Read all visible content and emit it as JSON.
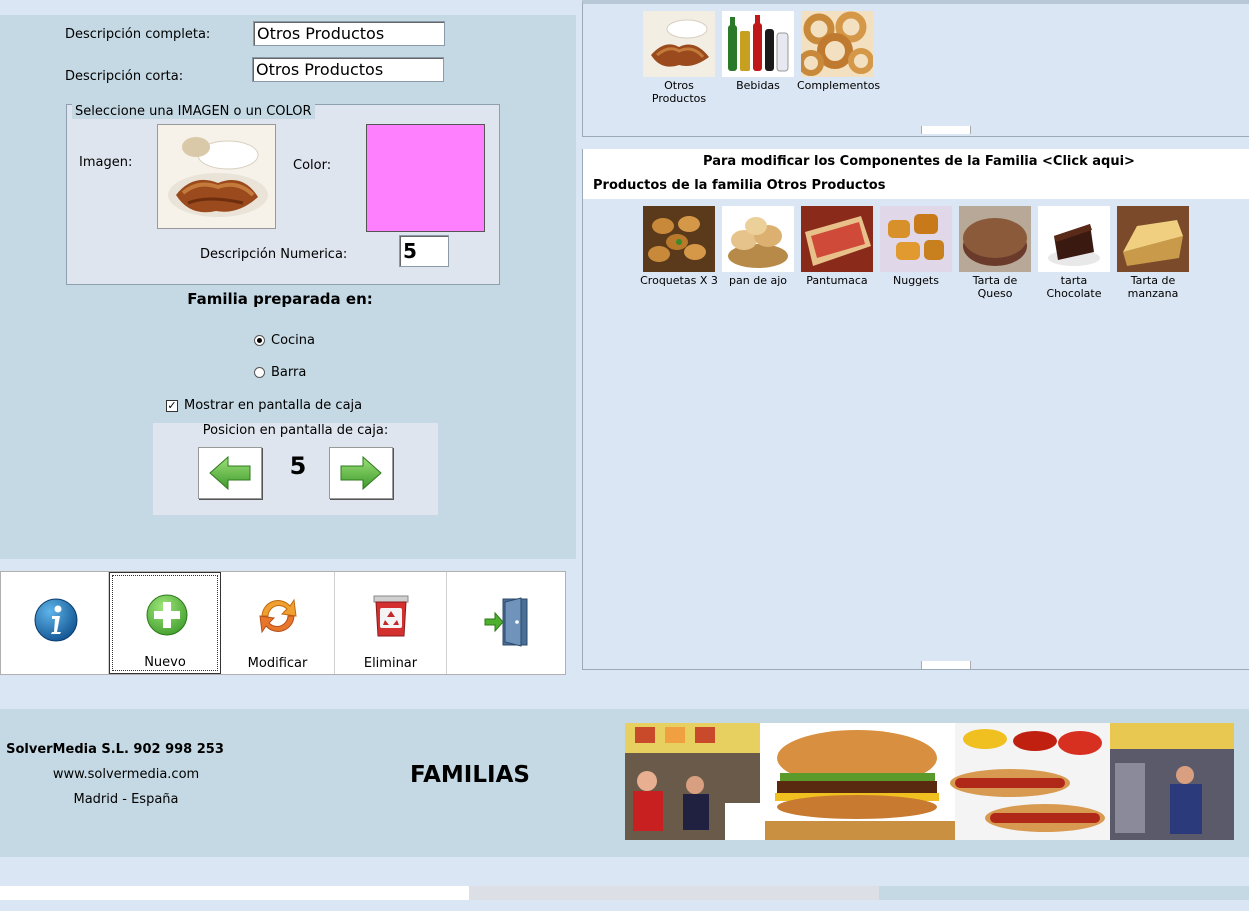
{
  "form": {
    "full_desc_label": "Descripción completa:",
    "full_desc_value": "Otros Productos",
    "short_desc_label": "Descripción corta:",
    "short_desc_value": "Otros Productos",
    "image_group_title": "Seleccione una IMAGEN o un COLOR",
    "image_label": "Imagen:",
    "color_label": "Color:",
    "color_value": "#ff80ff",
    "numeric_label": "Descripción Numerica:",
    "numeric_value": "5",
    "prepared_title": "Familia preparada en:",
    "options": [
      {
        "label": "Cocina",
        "selected": true
      },
      {
        "label": "Barra",
        "selected": false
      }
    ],
    "show_checkbox_label": "Mostrar en pantalla de caja",
    "show_checked": true,
    "position_title": "Posicion en pantalla de caja:",
    "position_value": "5"
  },
  "toolbar": {
    "info_icon": "info-icon",
    "new_label": "Nuevo",
    "modify_label": "Modificar",
    "delete_label": "Eliminar",
    "exit_icon": "exit-door-icon"
  },
  "families": [
    {
      "line1": "Otros",
      "line2": "Productos",
      "icon": "croissant-image"
    },
    {
      "line1": "Bebidas",
      "line2": "",
      "icon": "drinks-image"
    },
    {
      "line1": "Complementos",
      "line2": "",
      "icon": "onion-rings-image"
    }
  ],
  "components": {
    "modify_hint": "Para modificar los Componentes de la Familia <Click aqui>",
    "products_title": "Productos de la familia Otros Productos",
    "products": [
      {
        "line1": "Croquetas X 3",
        "line2": "",
        "icon": "croquetas-image"
      },
      {
        "line1": "pan de ajo",
        "line2": "",
        "icon": "garlic-bread-image"
      },
      {
        "line1": "Pantumaca",
        "line2": "",
        "icon": "pantumaca-image"
      },
      {
        "line1": "Nuggets",
        "line2": "",
        "icon": "nuggets-image"
      },
      {
        "line1": "Tarta de",
        "line2": "Queso",
        "icon": "cheesecake-image"
      },
      {
        "line1": "tarta",
        "line2": "Chocolate",
        "icon": "chocolate-cake-image"
      },
      {
        "line1": "Tarta de",
        "line2": "manzana",
        "icon": "apple-pie-image"
      }
    ]
  },
  "footer": {
    "company": "SolverMedia S.L. 902 998 253",
    "website": "www.solvermedia.com",
    "location": "Madrid - España",
    "section_title": "FAMILIAS",
    "banner": "fast-food-banner-image"
  }
}
